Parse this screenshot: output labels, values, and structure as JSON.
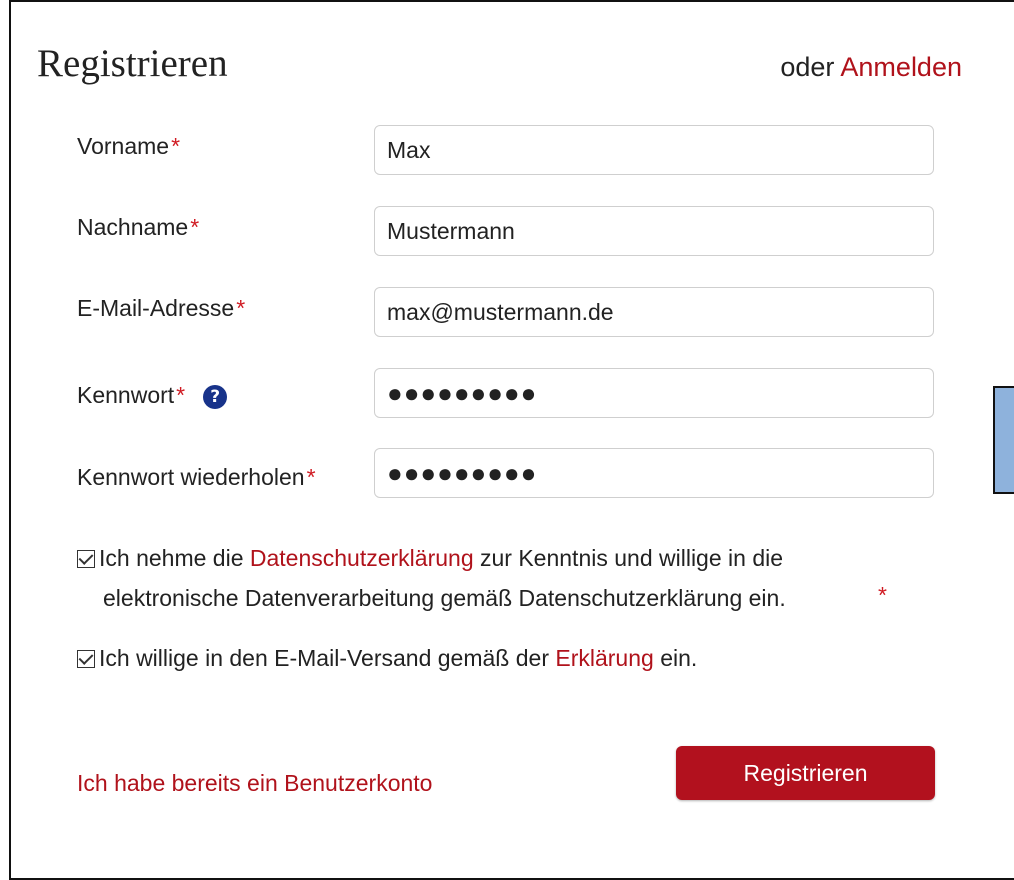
{
  "form": {
    "title": "Registrieren",
    "login_prefix": "oder",
    "login_link": "Anmelden",
    "required_marker": "*",
    "fields": {
      "first_name": {
        "label": "Vorname",
        "value": "Max"
      },
      "last_name": {
        "label": "Nachname",
        "value": "Mustermann"
      },
      "email": {
        "label": "E-Mail-Adresse",
        "value": "max@mustermann.de"
      },
      "password": {
        "label": "Kennwort",
        "value": "●●●●●●●●●",
        "help_icon": "?"
      },
      "password_repeat": {
        "label": "Kennwort wiederholen",
        "value": "●●●●●●●●●"
      }
    },
    "consent_privacy": {
      "checked": true,
      "text_before": "Ich nehme die",
      "link": "Datenschutzerklärung",
      "text_after": "zur Kenntnis und willige in die",
      "line2": "elektronische Datenverarbeitung gemäß Datenschutzerklärung ein."
    },
    "consent_email": {
      "checked": true,
      "text_before": "Ich willige in den E-Mail-Versand gemäß der",
      "link": "Erklärung",
      "text_after": "ein."
    },
    "existing_account_link": "Ich habe bereits ein Benutzerkonto",
    "submit_label": "Registrieren"
  },
  "colors": {
    "accent": "#b0121b",
    "required": "#d01b23",
    "help_icon": "#18338a",
    "side_box": "#8eb2dc"
  }
}
